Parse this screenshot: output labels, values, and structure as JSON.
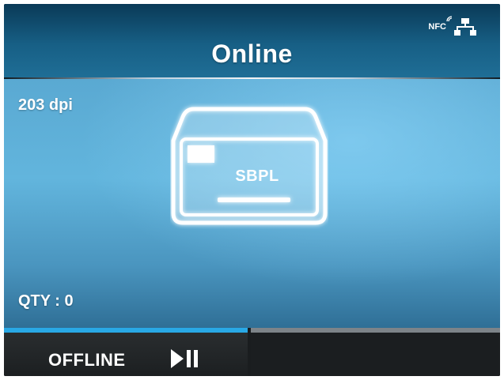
{
  "header": {
    "title": "Online",
    "nfc_label": "NFC",
    "icons": [
      "nfc-icon",
      "wired-network-icon"
    ]
  },
  "body": {
    "resolution": "203 dpi",
    "emulation_label": "SBPL",
    "quantity": "QTY : 0"
  },
  "bottom_bar": {
    "left_button_label": "OFFLINE",
    "left_button_icon": "play-pause-icon",
    "right_button_label": ""
  },
  "colors": {
    "header_bg": "#175f85",
    "body_bg": "#62b5dd",
    "active_indicator": "#29a9e6",
    "inactive_indicator": "#7d8489",
    "bottom_bg": "#1a1d1f"
  }
}
